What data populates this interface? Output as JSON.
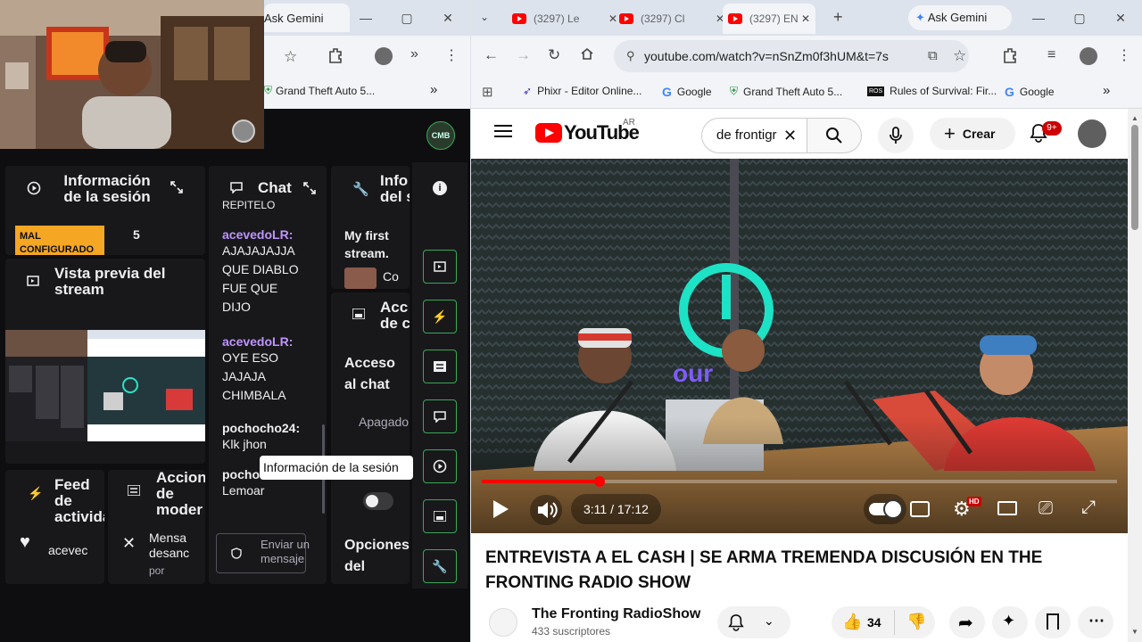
{
  "left_browser": {
    "tab_title": "Ask Gemini",
    "bookmark": "Grand Theft Auto 5...",
    "avatar_text": "CMB"
  },
  "session_info": {
    "title": "Información de la sesión",
    "badge": "MAL CONFIGURADO",
    "count": "5"
  },
  "chat": {
    "title": "Chat",
    "clipped_top": "REPITELO",
    "messages": [
      {
        "user": "acevedoLR:",
        "lines": [
          "AJAJAJAJJA",
          "QUE DIABLO",
          "FUE QUE",
          "DIJO"
        ]
      },
      {
        "user": "acevedoLR:",
        "lines": [
          "OYE ESO",
          "JAJAJA",
          "CHIMBALA"
        ]
      },
      {
        "user": "pochocho24:",
        "lines": [
          "Klk jhon"
        ]
      },
      {
        "user": "pocho",
        "lines": [
          "Lemoar"
        ]
      }
    ],
    "send_placeholder": "Enviar un mensaje"
  },
  "info_panel": {
    "title": "Info del s",
    "stream_name": "My first stream.",
    "sub": "Co"
  },
  "preview": {
    "title": "Vista previa del stream"
  },
  "actions_panel": {
    "title": "Acc de c",
    "chat_access": "Acceso al chat",
    "status": "Apagado",
    "options": "Opciones del"
  },
  "feed": {
    "title": "Feed de actividad",
    "item": "acevec",
    "heart": "♥"
  },
  "mod": {
    "title": "Acciones de moder",
    "item_title": "Mensa desanc",
    "item_sub": "por"
  },
  "tooltip": "Información de la sesión",
  "right_browser": {
    "tabs": [
      {
        "label": "(3297) Le"
      },
      {
        "label": "(3297) Cl"
      },
      {
        "label": "(3297) EN"
      }
    ],
    "gemini": "Ask Gemini",
    "url": "youtube.com/watch?v=nSnZm0f3hUM&t=7s",
    "bookmarks": [
      "Phixr - Editor Online...",
      "Google",
      "Grand Theft Auto 5...",
      "Rules of Survival: Fir...",
      "Google"
    ],
    "more": "»"
  },
  "youtube": {
    "logo": "YouTube",
    "region": "AR",
    "search_value": "de frontigr",
    "create": "Crear",
    "notif_count": "9+",
    "time": "3:11 / 17:12",
    "progress": 0.185,
    "hd": "HD",
    "video_title": "ENTREVISTA A EL CASH | SE ARMA TREMENDA DISCUSIÓN EN THE FRONTING RADIO SHOW",
    "channel": "The Fronting RadioShow",
    "subs": "433 suscriptores",
    "likes": "34",
    "neon_text": "our"
  },
  "colors": {
    "twitch_purple": "#bf94ff",
    "yt_red": "#ff0000",
    "green_border": "#3aa757",
    "badge_yellow": "#f5a623"
  }
}
